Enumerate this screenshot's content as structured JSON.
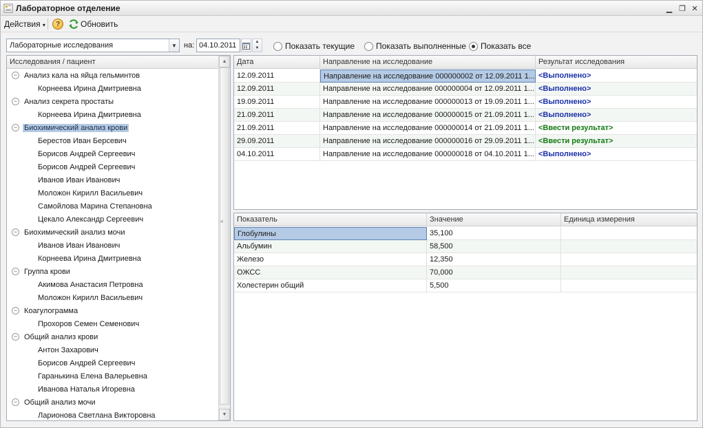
{
  "window": {
    "title": "Лабораторное отделение"
  },
  "toolbar": {
    "actions_label": "Действия",
    "help_label": "?",
    "refresh_label": "Обновить"
  },
  "filter": {
    "study_type": "Лабораторные исследования",
    "date_label": "на:",
    "date_value": "04.10.2011",
    "radios": [
      {
        "label": "Показать текущие",
        "selected": false
      },
      {
        "label": "Показать выполненные",
        "selected": false
      },
      {
        "label": "Показать все",
        "selected": true
      }
    ]
  },
  "tree": {
    "header": "Исследования / пациент",
    "rows": [
      {
        "type": "group",
        "label": "Анализ кала на яйца гельминтов"
      },
      {
        "type": "child",
        "label": "Корнеева Ирина Дмитриевна"
      },
      {
        "type": "group",
        "label": "Анализ секрета простаты"
      },
      {
        "type": "child",
        "label": "Корнеева Ирина Дмитриевна"
      },
      {
        "type": "group",
        "label": "Биохимический анализ крови",
        "selected": true
      },
      {
        "type": "child",
        "label": "Берестов Иван Берсевич"
      },
      {
        "type": "child",
        "label": "Борисов Андрей Сергеевич"
      },
      {
        "type": "child",
        "label": "Борисов Андрей Сергеевич"
      },
      {
        "type": "child",
        "label": "Иванов Иван Иванович"
      },
      {
        "type": "child",
        "label": "Моложон Кирилл Васильевич"
      },
      {
        "type": "child",
        "label": "Самойлова Марина Степановна"
      },
      {
        "type": "child",
        "label": "Цекало Александр Сергеевич"
      },
      {
        "type": "group",
        "label": "Биохимический анализ мочи"
      },
      {
        "type": "child",
        "label": "Иванов Иван Иванович"
      },
      {
        "type": "child",
        "label": "Корнеева Ирина Дмитриевна"
      },
      {
        "type": "group",
        "label": "Группа крови"
      },
      {
        "type": "child",
        "label": "Акимова Анастасия Петровна"
      },
      {
        "type": "child",
        "label": "Моложон Кирилл Васильевич"
      },
      {
        "type": "group",
        "label": "Коагулограмма"
      },
      {
        "type": "child",
        "label": "Прохоров Семен Семенович"
      },
      {
        "type": "group",
        "label": "Общий анализ крови"
      },
      {
        "type": "child",
        "label": "Антон Захарович"
      },
      {
        "type": "child",
        "label": "Борисов Андрей Сергеевич"
      },
      {
        "type": "child",
        "label": "Гаранькина Елена Валерьевна"
      },
      {
        "type": "child",
        "label": "Иванова Наталья Игоревна"
      },
      {
        "type": "group",
        "label": "Общий анализ мочи"
      },
      {
        "type": "child",
        "label": "Ларионова Светлана Викторовна"
      }
    ]
  },
  "referrals": {
    "columns": [
      "Дата",
      "Направление на исследование",
      "Результат исследования"
    ],
    "rows": [
      {
        "date": "12.09.2011",
        "referral": "Направление на исследование 000000002 от 12.09.2011 1...",
        "result": "<Выполнено>",
        "status": "done",
        "selected": true
      },
      {
        "date": "12.09.2011",
        "referral": "Направление на исследование 000000004 от 12.09.2011 1...",
        "result": "<Выполнено>",
        "status": "done"
      },
      {
        "date": "19.09.2011",
        "referral": "Направление на исследование 000000013 от 19.09.2011 1...",
        "result": "<Выполнено>",
        "status": "done"
      },
      {
        "date": "21.09.2011",
        "referral": "Направление на исследование 000000015 от 21.09.2011 1...",
        "result": "<Выполнено>",
        "status": "done"
      },
      {
        "date": "21.09.2011",
        "referral": "Направление на исследование 000000014 от 21.09.2011 1...",
        "result": "<Ввести результат>",
        "status": "enter"
      },
      {
        "date": "29.09.2011",
        "referral": "Направление на исследование 000000016 от 29.09.2011 1...",
        "result": "<Ввести результат>",
        "status": "enter"
      },
      {
        "date": "04.10.2011",
        "referral": "Направление на исследование 000000018 от 04.10.2011 1...",
        "result": "<Выполнено>",
        "status": "done"
      }
    ]
  },
  "indicators": {
    "columns": [
      "Показатель",
      "Значение",
      "Единица измерения"
    ],
    "rows": [
      {
        "name": "Глобулины",
        "value": "35,100",
        "unit": "",
        "selected": true
      },
      {
        "name": "Альбумин",
        "value": "58,500",
        "unit": ""
      },
      {
        "name": "Железо",
        "value": "12,350",
        "unit": ""
      },
      {
        "name": "ОЖСС",
        "value": "70,000",
        "unit": ""
      },
      {
        "name": "Холестерин общий",
        "value": "5,500",
        "unit": ""
      }
    ]
  },
  "colors": {
    "selection": "#b5cbe5",
    "done": "#1a2fa8",
    "enter": "#137a14"
  }
}
